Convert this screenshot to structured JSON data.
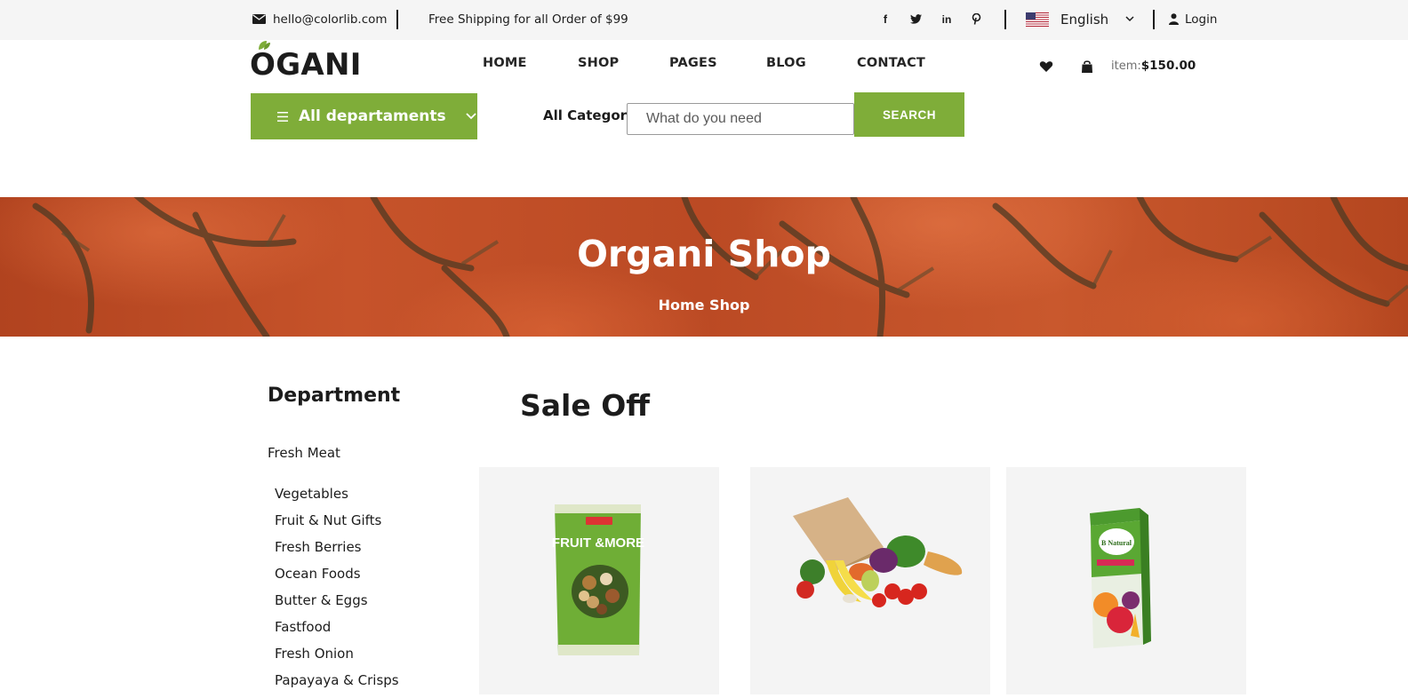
{
  "topbar": {
    "email": "hello@colorlib.com",
    "shipping": "Free Shipping for all Order of $99",
    "language": "English",
    "login": "Login",
    "social": [
      "f",
      "t",
      "in",
      "p"
    ]
  },
  "header": {
    "logo": "OGANI",
    "nav": [
      "HOME",
      "SHOP",
      "PAGES",
      "BLOG",
      "CONTACT"
    ],
    "cart_label": "item:",
    "cart_total": "$150.00"
  },
  "hero": {
    "departments_label": "All departaments",
    "categories_label": "All Categories",
    "search_placeholder": "What do you need",
    "search_button": "SEARCH"
  },
  "banner": {
    "title": "Organi Shop",
    "breadcrumb": "Home Shop"
  },
  "sidebar": {
    "title": "Department",
    "first_item": "Fresh Meat",
    "items": [
      "Vegetables",
      "Fruit & Nut Gifts",
      "Fresh Berries",
      "Ocean Foods",
      "Butter & Eggs",
      "Fastfood",
      "Fresh Onion",
      "Papayaya & Crisps"
    ]
  },
  "sale": {
    "title": "Sale Off",
    "products": [
      {
        "image": "fruit-and-nut-pack-image",
        "pack_text": "FRUIT &MORE"
      },
      {
        "image": "grocery-bag-image"
      },
      {
        "image": "mixed-fruit-juice-image",
        "pack_text": "B Natural"
      }
    ]
  },
  "colors": {
    "accent": "#7fad39",
    "topbar_bg": "#f5f5f5",
    "banner": "#c0502a"
  }
}
